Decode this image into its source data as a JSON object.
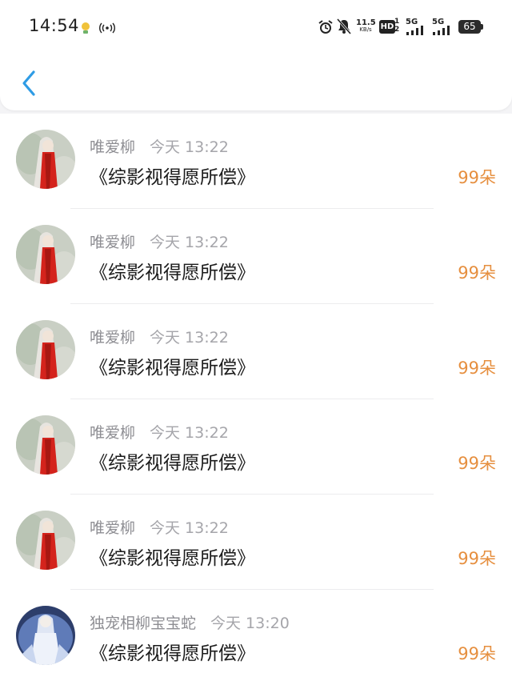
{
  "status_bar": {
    "time": "14:54",
    "net_speed_value": "11.5",
    "net_speed_unit": "KB/s",
    "hd_label": "HD",
    "sim1": "1",
    "sim2": "2",
    "net1": "5G",
    "net2": "5G",
    "battery": "65"
  },
  "colors": {
    "accent": "#2f9ce5",
    "amount": "#e68f3f",
    "robe_red": "#d4231c"
  },
  "items": [
    {
      "name": "唯爱柳",
      "time": "今天 13:22",
      "title": "《综影视得愿所偿》",
      "amount": "99朵",
      "avatar": "red-robe"
    },
    {
      "name": "唯爱柳",
      "time": "今天 13:22",
      "title": "《综影视得愿所偿》",
      "amount": "99朵",
      "avatar": "red-robe"
    },
    {
      "name": "唯爱柳",
      "time": "今天 13:22",
      "title": "《综影视得愿所偿》",
      "amount": "99朵",
      "avatar": "red-robe"
    },
    {
      "name": "唯爱柳",
      "time": "今天 13:22",
      "title": "《综影视得愿所偿》",
      "amount": "99朵",
      "avatar": "red-robe"
    },
    {
      "name": "唯爱柳",
      "time": "今天 13:22",
      "title": "《综影视得愿所偿》",
      "amount": "99朵",
      "avatar": "red-robe"
    },
    {
      "name": "独宠相柳宝宝蛇",
      "time": "今天 13:20",
      "title": "《综影视得愿所偿》",
      "amount": "99朵",
      "avatar": "white-blue"
    }
  ]
}
